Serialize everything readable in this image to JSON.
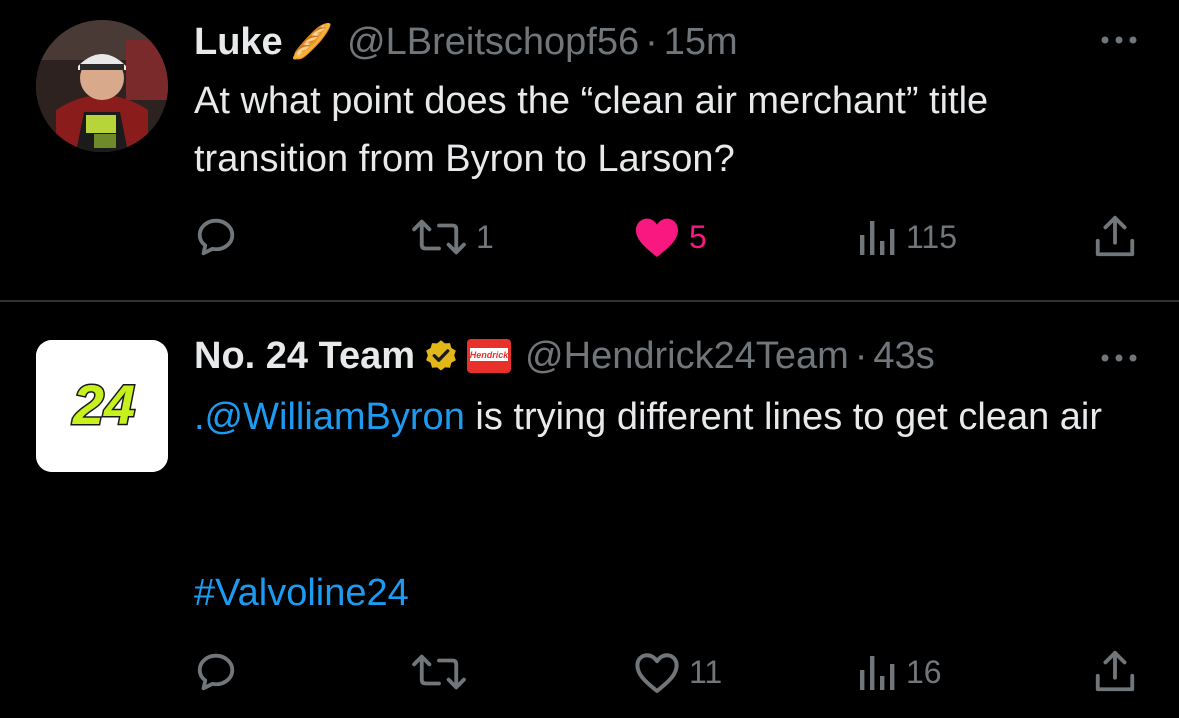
{
  "tweets": [
    {
      "author_name": "Luke",
      "author_emoji": "🥖",
      "handle": "@LBreitschopf56",
      "time": "15m",
      "text": "At what point does the “clean air merchant” title transition from Byron to Larson?",
      "actions": {
        "reply_count": "",
        "retweet_count": "1",
        "like_count": "5",
        "liked": true,
        "view_count": "115"
      }
    },
    {
      "author_name": "No. 24 Team",
      "handle": "@Hendrick24Team",
      "time": "43s",
      "affiliate_badge_text": "Hendrick",
      "avatar_text": "24",
      "text_mention": ".@WilliamByron",
      "text_rest": " is trying different lines to get clean air",
      "hashtag": "#Valvoline24",
      "actions": {
        "reply_count": "",
        "retweet_count": "",
        "like_count": "11",
        "liked": false,
        "view_count": "16"
      }
    }
  ],
  "colors": {
    "background": "#000000",
    "text": "#e7e9ea",
    "secondary": "#71767b",
    "link": "#1d9bf0",
    "like": "#f91880",
    "verified_gold": "#e2b719",
    "avatar_24_green": "#c6f11e"
  },
  "icons": {
    "reply": "reply-icon",
    "retweet": "retweet-icon",
    "like": "heart-icon",
    "views": "views-icon",
    "share": "share-icon",
    "more": "more-icon",
    "verified": "verified-gold-icon"
  }
}
